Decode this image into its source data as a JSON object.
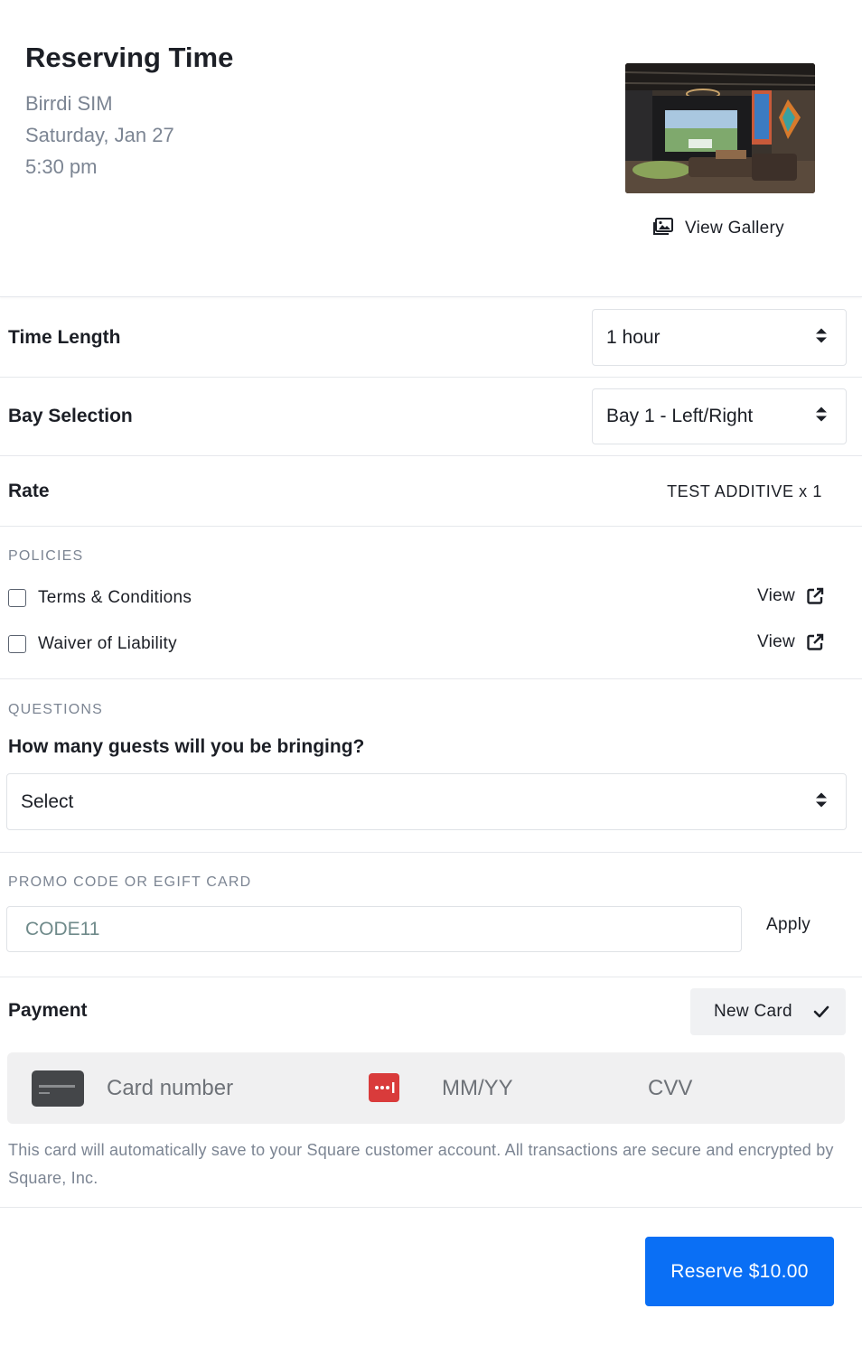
{
  "header": {
    "title": "Reserving Time",
    "venue": "Birrdi SIM",
    "date": "Saturday, Jan 27",
    "time": "5:30 pm",
    "gallery_label": "View Gallery"
  },
  "time_length": {
    "label": "Time Length",
    "value": "1 hour"
  },
  "bay_selection": {
    "label": "Bay Selection",
    "value": "Bay 1 - Left/Right"
  },
  "rate": {
    "label": "Rate",
    "value": "TEST ADDITIVE x 1"
  },
  "policies": {
    "title": "POLICIES",
    "items": [
      {
        "label": "Terms & Conditions",
        "view_label": "View",
        "checked": false
      },
      {
        "label": "Waiver of Liability",
        "view_label": "View",
        "checked": false
      }
    ]
  },
  "questions": {
    "title": "QUESTIONS",
    "question": "How many guests will you be bringing?",
    "select_value": "Select"
  },
  "promo": {
    "title": "PROMO CODE OR EGIFT CARD",
    "placeholder": "CODE11",
    "apply_label": "Apply"
  },
  "payment": {
    "label": "Payment",
    "card_mode": "New Card",
    "card_number_placeholder": "Card number",
    "expiry_placeholder": "MM/YY",
    "cvv_placeholder": "CVV",
    "note": "This card will automatically save to your Square customer account. All transactions are secure and encrypted by Square, Inc."
  },
  "reserve_label": "Reserve $10.00",
  "colors": {
    "accent": "#0a6ff5",
    "muted_text": "#7c8593",
    "cvv_icon": "#d93b3b"
  }
}
